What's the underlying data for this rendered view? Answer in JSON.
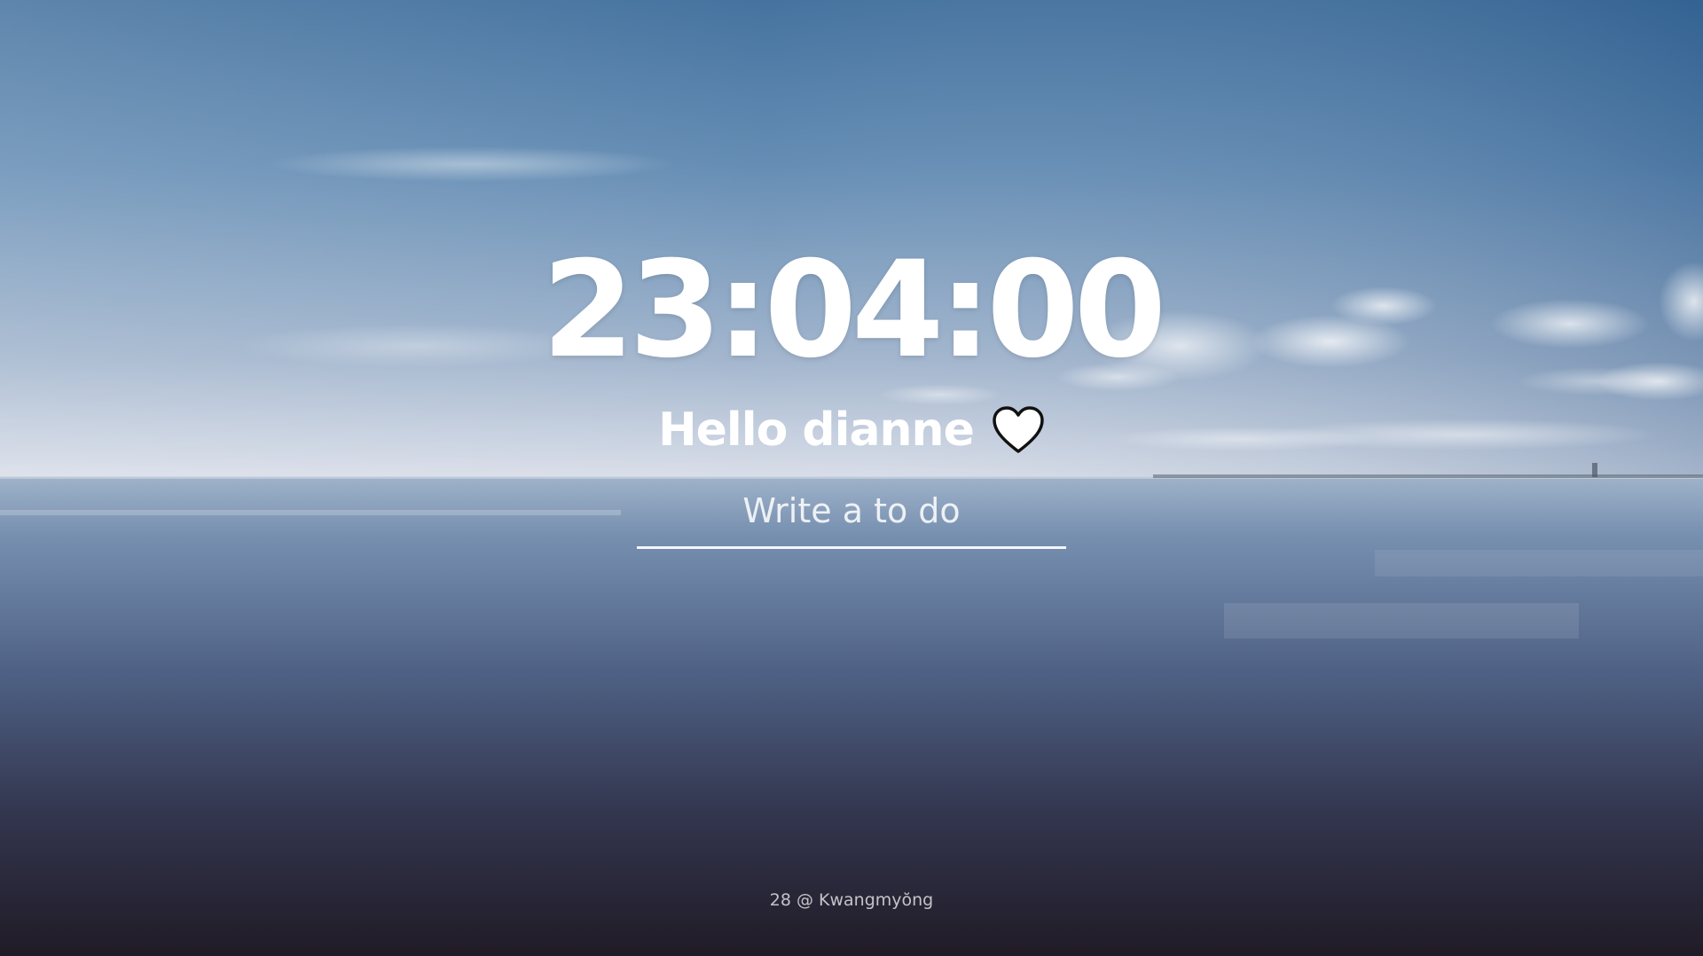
{
  "clock": {
    "time": "23:04:00"
  },
  "greeting": {
    "text": "Hello dianne",
    "icon": "heart-icon"
  },
  "todo": {
    "placeholder": "Write a to do",
    "value": ""
  },
  "footer": {
    "text": "28 @ Kwangmyŏng"
  },
  "colors": {
    "text": "#ffffff",
    "sky_top": "#2e5d8f",
    "horizon": "#d7dde7",
    "water_deep": "#201b26"
  }
}
